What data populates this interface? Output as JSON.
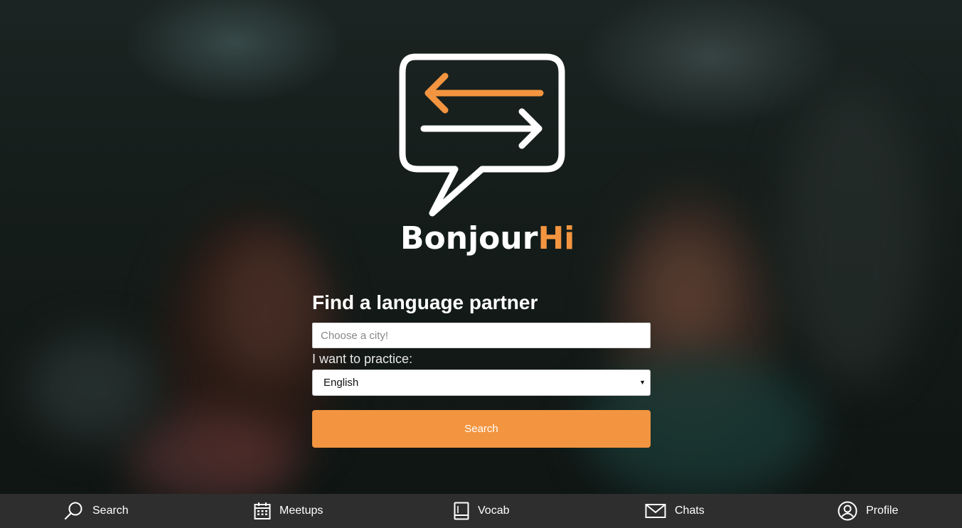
{
  "brand": {
    "name_main": "Bonjour",
    "name_accent": "Hi",
    "accent_color": "#f39540"
  },
  "form": {
    "title": "Find a language partner",
    "city_placeholder": "Choose a city!",
    "city_value": "",
    "practice_label": "I want to practice:",
    "practice_selected": "English",
    "search_label": "Search"
  },
  "nav": {
    "items": [
      {
        "label": "Search",
        "icon": "search-icon"
      },
      {
        "label": "Meetups",
        "icon": "calendar-icon"
      },
      {
        "label": "Vocab",
        "icon": "book-icon"
      },
      {
        "label": "Chats",
        "icon": "mail-icon"
      },
      {
        "label": "Profile",
        "icon": "profile-icon"
      }
    ]
  },
  "colors": {
    "button": "#f39540",
    "nav_bg": "#2e2e2e"
  }
}
